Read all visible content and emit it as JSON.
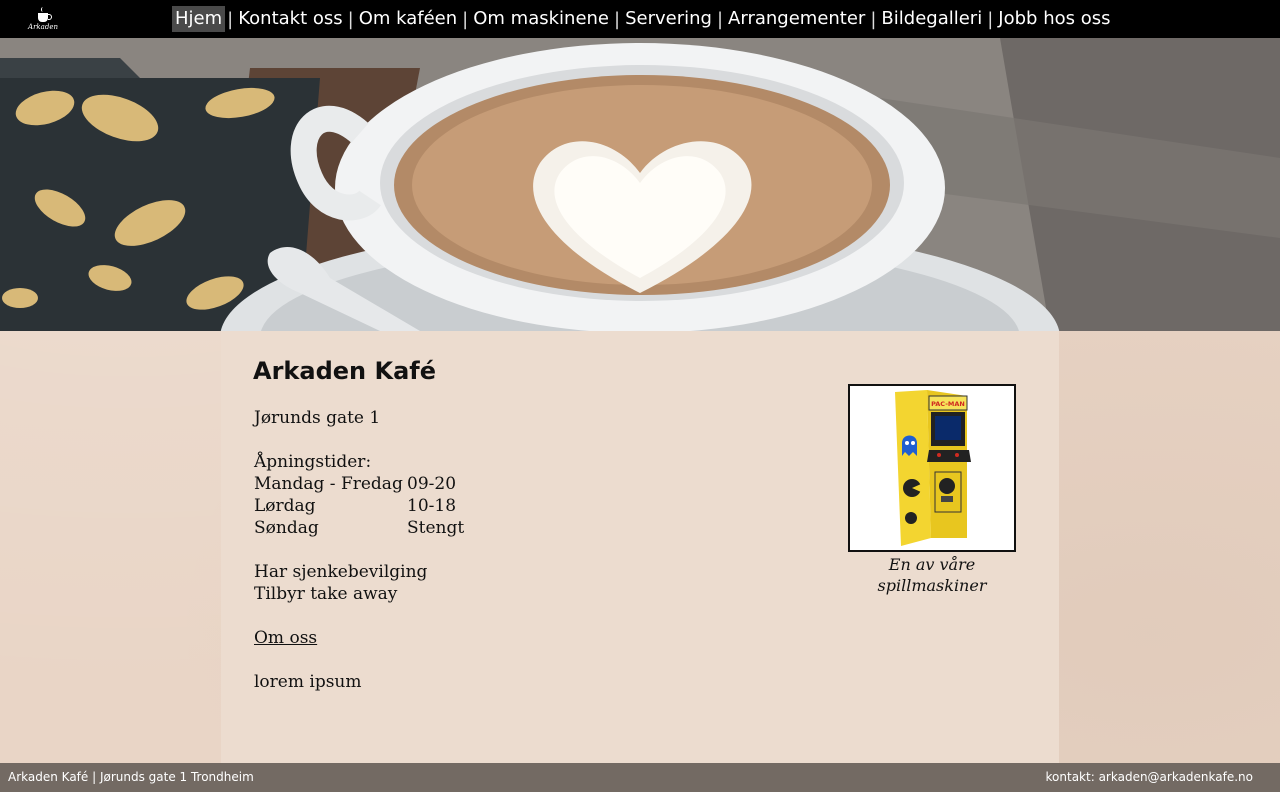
{
  "header": {
    "logo_text": "Arkaden",
    "nav": [
      {
        "label": "Hjem",
        "active": true
      },
      {
        "label": "Kontakt oss",
        "active": false
      },
      {
        "label": "Om kaféen",
        "active": false
      },
      {
        "label": "Om maskinene",
        "active": false
      },
      {
        "label": "Servering",
        "active": false
      },
      {
        "label": "Arrangementer",
        "active": false
      },
      {
        "label": "Bildegalleri",
        "active": false
      },
      {
        "label": "Jobb hos oss",
        "active": false
      }
    ],
    "separator": "|"
  },
  "main": {
    "title": "Arkaden Kafé",
    "address": "Jørunds gate 1",
    "hours_heading": "Åpningstider:",
    "hours": [
      {
        "day": "Mandag - Fredag",
        "time": "09-20"
      },
      {
        "day": "Lørdag",
        "time": "10-18"
      },
      {
        "day": "Søndag",
        "time": "Stengt"
      }
    ],
    "license": "Har sjenkebevilging",
    "takeaway": "Tilbyr take away",
    "about_link": "Om oss",
    "filler": "lorem ipsum",
    "figure_caption": "En av våre spillmaskiner",
    "arcade_marquee": "PAC-MAN"
  },
  "footer": {
    "left": "Arkaden Kafé | Jørunds gate 1 Trondheim",
    "right": "kontakt: arkaden@arkadenkafe.no"
  },
  "colors": {
    "topbar": "#000000",
    "footer": "#736a63",
    "content_bg": "#ecdccf",
    "page_bg": "#e9d5c6"
  }
}
